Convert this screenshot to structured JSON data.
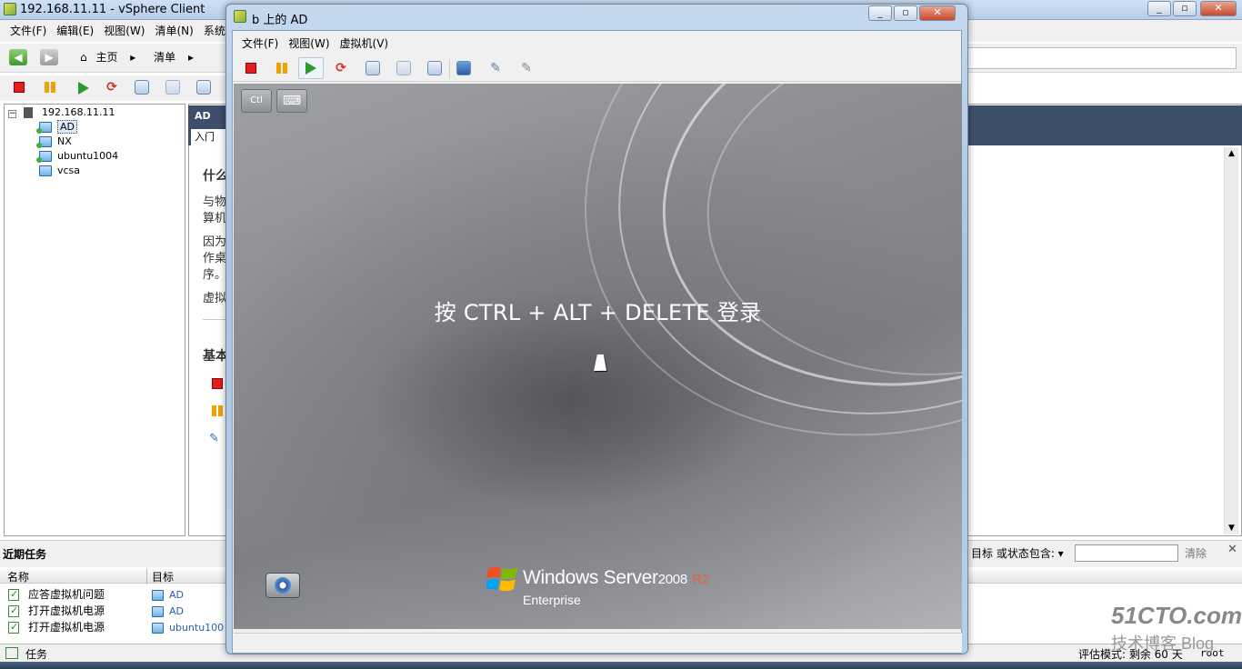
{
  "main_window": {
    "title": "192.168.11.11 - vSphere Client",
    "menu": [
      "文件(F)",
      "编辑(E)",
      "视图(W)",
      "清单(N)",
      "系统"
    ],
    "nav": {
      "home": "主页",
      "inventory": "清单"
    }
  },
  "tree": {
    "host": "192.168.11.11",
    "vms": [
      "AD",
      "NX",
      "ubuntu1004",
      "vcsa"
    ]
  },
  "content": {
    "header": "AD",
    "tab": "入门",
    "heading": "什么",
    "lines": [
      "与物",
      "算机",
      "因为",
      "作桌",
      "序。",
      "虚拟"
    ],
    "basic_heading": "基本"
  },
  "recent_tasks": {
    "title": "近期任务",
    "filter_label": "目标 或状态包含: ▾",
    "filter_value": "",
    "clear": "清除",
    "columns": [
      "名称",
      "目标"
    ],
    "rows": [
      {
        "name": "应答虚拟机问题",
        "target": "AD"
      },
      {
        "name": "打开虚拟机电源",
        "target": "AD"
      },
      {
        "name": "打开虚拟机电源",
        "target": "ubuntu100"
      }
    ]
  },
  "status_bar": {
    "tasks": "任务",
    "eval": "评估模式: 剩余 60 天",
    "user": "root"
  },
  "console": {
    "title": "b 上的 AD",
    "menu": [
      "文件(F)",
      "视图(W)",
      "虚拟机(V)"
    ],
    "ctrl_label": "Ctl",
    "login_message": "按 CTRL + ALT + DELETE 登录",
    "os_name": "Windows Server",
    "os_version": "2008",
    "os_release": "R2",
    "os_edition": "Enterprise"
  },
  "watermark": {
    "line1": "51CTO.com",
    "line2": "技术博客 Blog"
  }
}
